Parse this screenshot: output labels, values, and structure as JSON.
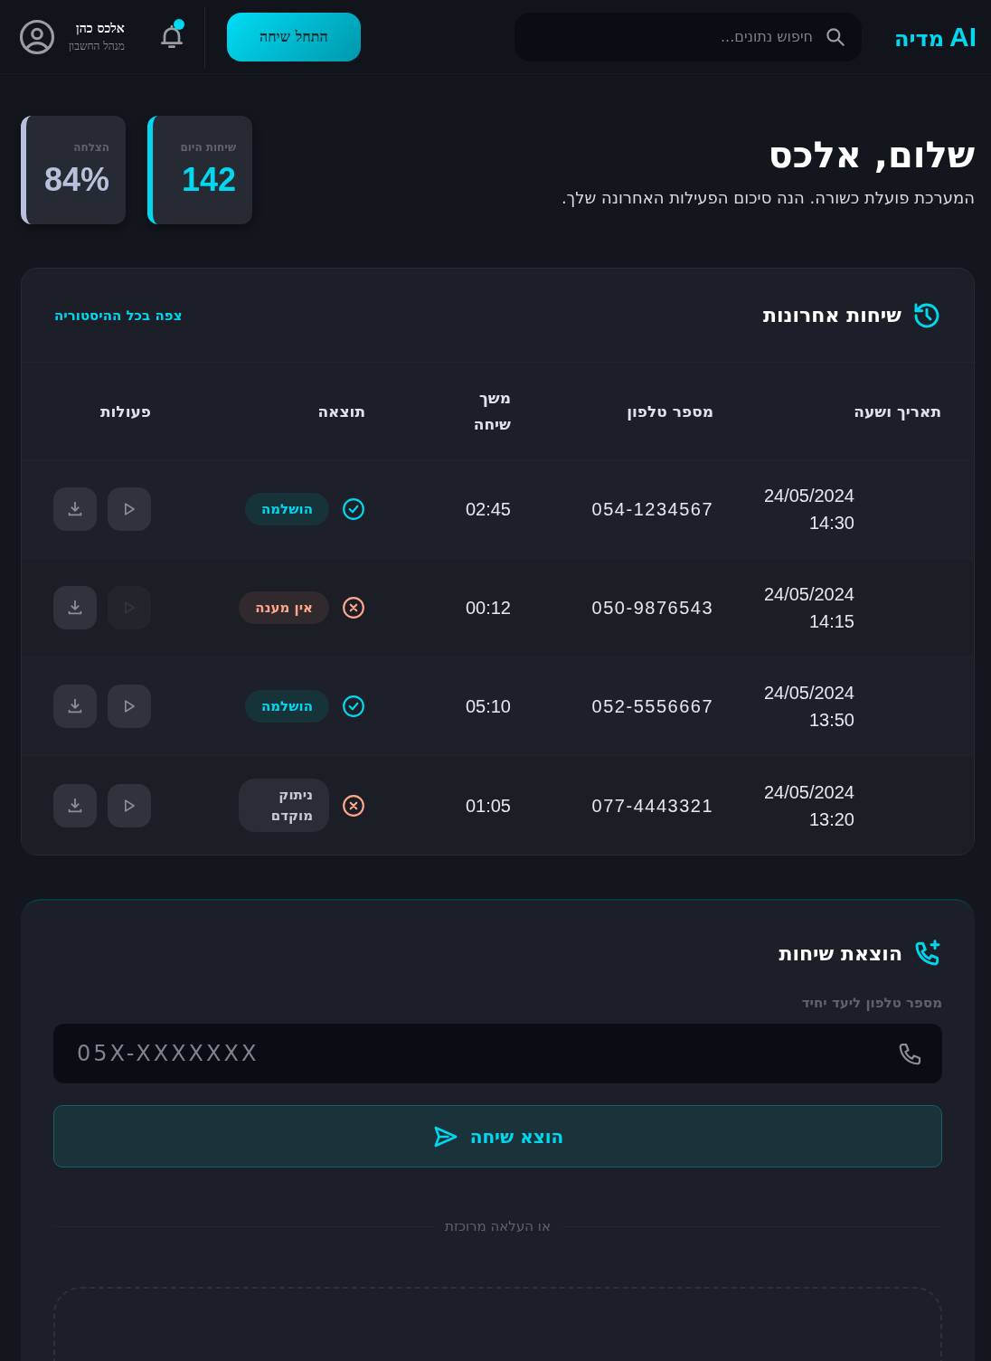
{
  "header": {
    "logo": {
      "mark": "AI",
      "name": "מדיה"
    },
    "search": {
      "placeholder": "חיפוש נתונים..."
    },
    "start_button": "התחל שיחה",
    "notifications": {
      "unread": true
    },
    "user": {
      "name": "אלכס כהן",
      "role": "מנהל החשבון"
    }
  },
  "greeting": {
    "title": "שלום, אלכס",
    "subtitle": "המערכת פועלת כשורה. הנה סיכום הפעילות האחרונה שלך."
  },
  "stats": [
    {
      "label": "שיחות היום",
      "value": "142",
      "color": "#00d8f0"
    },
    {
      "label": "הצלחה",
      "value": "84%",
      "color": "#b8c0dc"
    }
  ],
  "recent_calls": {
    "title": "שיחות אחרונות",
    "view_all": "צפה בכל ההיסטוריה",
    "columns": [
      "תאריך ושעה",
      "מספר טלפון",
      "משך שיחה",
      "תוצאה",
      "פעולות"
    ],
    "rows": [
      {
        "datetime": "24/05/2024 14:30",
        "phone": "054-1234567",
        "duration": "02:45",
        "result": "הושלמה",
        "kind": "success",
        "playable": true
      },
      {
        "datetime": "24/05/2024 14:15",
        "phone": "050-9876543",
        "duration": "00:12",
        "result": "אין מענה",
        "kind": "no_answer",
        "playable": false
      },
      {
        "datetime": "24/05/2024 13:50",
        "phone": "052-5556667",
        "duration": "05:10",
        "result": "הושלמה",
        "kind": "success",
        "playable": true
      },
      {
        "datetime": "24/05/2024 13:20",
        "phone": "077-4443321",
        "duration": "01:05",
        "result": "ניתוק מוקדם",
        "kind": "dropped",
        "playable": true
      }
    ]
  },
  "dialer": {
    "title": "הוצאת שיחות",
    "field_label": "מספר טלפון ליעד יחיד",
    "placeholder": "05X-XXXXXXX",
    "submit": "הוצא שיחה",
    "divider": "או העלאה מרוכזת"
  }
}
